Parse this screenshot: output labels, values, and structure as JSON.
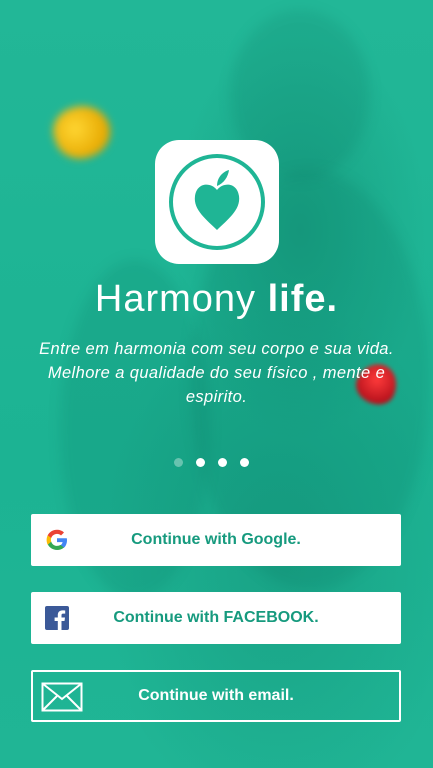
{
  "hero": {
    "title_light": "Harmony",
    "title_bold": "life.",
    "subtitle": "Entre em harmonia com seu corpo e sua vida. Melhore a qualidade do seu físico , mente e espirito."
  },
  "pager": {
    "count": 4,
    "active_index": 0
  },
  "buttons": {
    "google": "Continue with Google.",
    "facebook": "Continue with FACEBOOK.",
    "email": "Continue with email."
  },
  "colors": {
    "background": "#1fb595",
    "accent": "#169a7e",
    "white": "#ffffff"
  },
  "icons": {
    "app": "heart-apple-icon",
    "google": "google-icon",
    "facebook": "facebook-icon",
    "email": "envelope-icon"
  }
}
